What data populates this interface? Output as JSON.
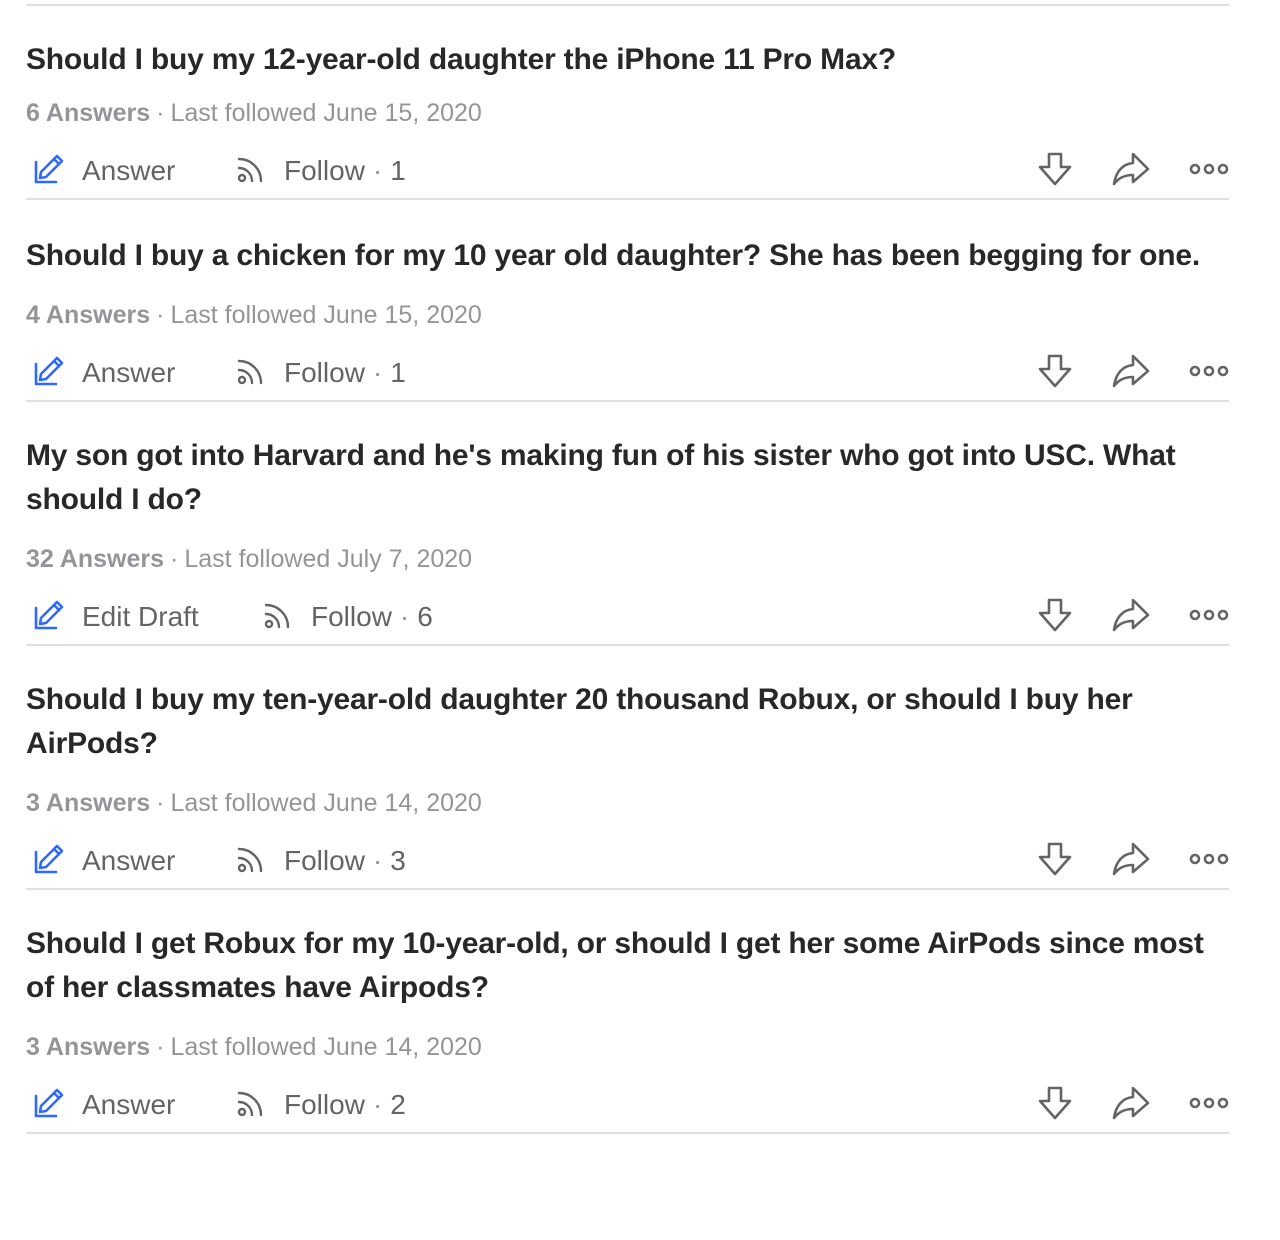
{
  "questions": [
    {
      "title": "Should I buy my 12-year-old daughter the iPhone 11 Pro Max?",
      "answers": "6 Answers",
      "followed": "Last followed June 15, 2020",
      "primary_action": "Answer",
      "follow_label": "Follow",
      "follow_count": "1"
    },
    {
      "title": "Should I buy a chicken for my 10 year old daughter? She has been begging for one.",
      "answers": "4 Answers",
      "followed": "Last followed June 15, 2020",
      "primary_action": "Answer",
      "follow_label": "Follow",
      "follow_count": "1"
    },
    {
      "title": "My son got into Harvard and he's making fun of his sister who got into USC. What should I do?",
      "answers": "32 Answers",
      "followed": "Last followed July 7, 2020",
      "primary_action": "Edit Draft",
      "follow_label": "Follow",
      "follow_count": "6"
    },
    {
      "title": "Should I buy my ten-year-old daughter 20 thousand Robux, or should I buy her AirPods?",
      "answers": "3 Answers",
      "followed": "Last followed June 14, 2020",
      "primary_action": "Answer",
      "follow_label": "Follow",
      "follow_count": "3"
    },
    {
      "title": "Should I get Robux for my 10-year-old, or should I get her some AirPods since most of her classmates have Airpods?",
      "answers": "3 Answers",
      "followed": "Last followed June 14, 2020",
      "primary_action": "Answer",
      "follow_label": "Follow",
      "follow_count": "2"
    }
  ],
  "separator": "·",
  "icons": {
    "answer": "pencil-edit-icon",
    "follow": "rss-follow-icon",
    "downvote": "downvote-arrow-icon",
    "share": "share-arrow-icon",
    "more": "more-dots-icon"
  },
  "colors": {
    "accent_blue": "#2e69ff",
    "title": "#282829",
    "meta": "#939598",
    "action": "#636466",
    "divider": "#dee0e1"
  }
}
